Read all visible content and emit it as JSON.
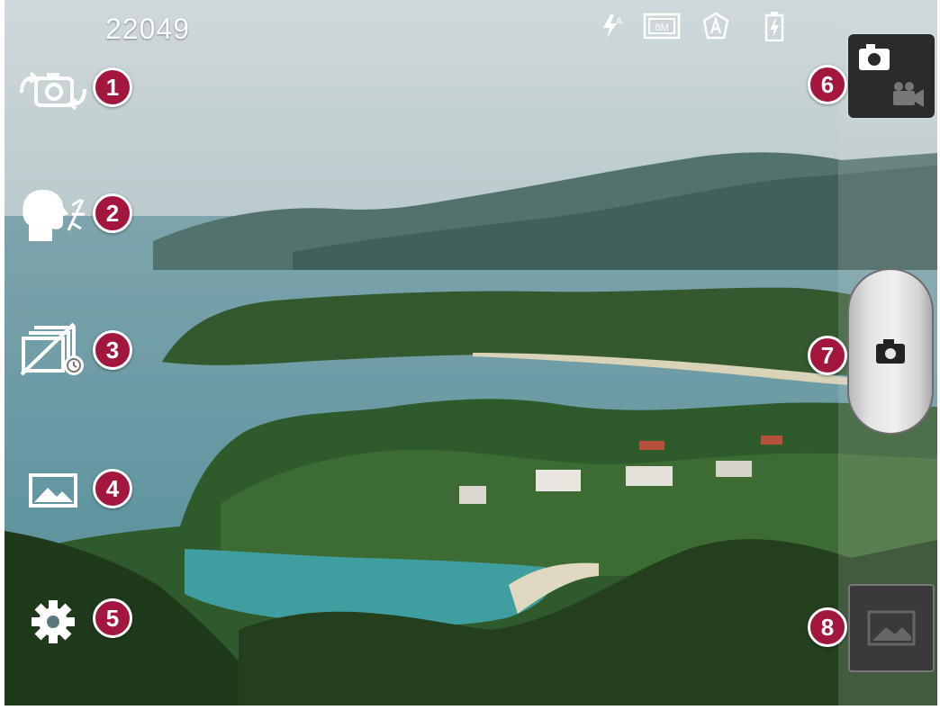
{
  "hud": {
    "shot_count": "22049"
  },
  "status_icons": [
    "flash-auto-icon",
    "resolution-8m-icon",
    "scene-auto-icon",
    "battery-charging-icon"
  ],
  "status_text": {
    "resolution": "8M",
    "flash_sub": "A"
  },
  "left_controls": [
    {
      "name": "swap-camera-icon",
      "badge": "1"
    },
    {
      "name": "cheese-shutter-icon",
      "badge": "2"
    },
    {
      "name": "time-machine-icon",
      "badge": "3"
    },
    {
      "name": "scene-mode-icon",
      "badge": "4"
    },
    {
      "name": "settings-gear-icon",
      "badge": "5"
    }
  ],
  "right_controls": [
    {
      "name": "camera-video-mode-switch",
      "badge": "6"
    },
    {
      "name": "shutter-button",
      "badge": "7"
    },
    {
      "name": "gallery-thumbnail",
      "badge": "8"
    }
  ],
  "colors": {
    "badge": "#a3173f",
    "icon": "#ffffff"
  }
}
